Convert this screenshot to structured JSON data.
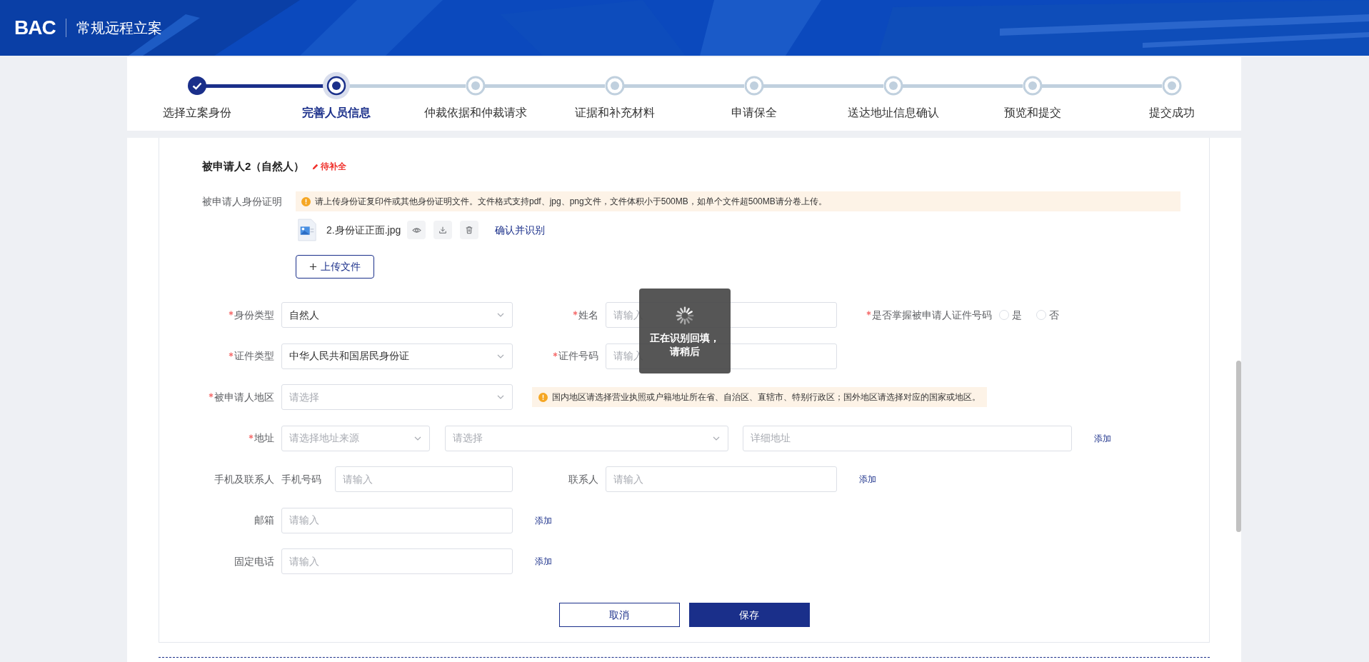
{
  "header": {
    "logo": "BAC",
    "title": "常规远程立案"
  },
  "steps": [
    {
      "label": "选择立案身份",
      "completed": true,
      "selected": false
    },
    {
      "label": "完善人员信息",
      "completed": false,
      "selected": true
    },
    {
      "label": "仲裁依据和仲裁请求",
      "completed": false,
      "selected": false
    },
    {
      "label": "证据和补充材料",
      "completed": false,
      "selected": false
    },
    {
      "label": "申请保全",
      "completed": false,
      "selected": false
    },
    {
      "label": "送达地址信息确认",
      "completed": false,
      "selected": false
    },
    {
      "label": "预览和提交",
      "completed": false,
      "selected": false
    },
    {
      "label": "提交成功",
      "completed": false,
      "selected": false
    }
  ],
  "party": {
    "title": "被申请人2（自然人）",
    "badge": "待补全",
    "id_proof": {
      "label": "被申请人身份证明",
      "tip": "请上传身份证复印件或其他身份证明文件。文件格式支持pdf、jpg、png文件，文件体积小于500MB，如单个文件超500MB请分卷上传。",
      "file": {
        "name": "2.身份证正面.jpg",
        "action": "确认并识别"
      },
      "upload_button": "上传文件"
    },
    "rows": [
      {
        "label": "身份类型",
        "required": true,
        "items": [
          {
            "kind": "select",
            "value": "自然人"
          },
          {
            "kind": "input",
            "label": "姓名",
            "required": true,
            "placeholder": "请输入"
          },
          {
            "kind": "radio_group",
            "label": "是否掌握被申请人证件号码",
            "required": true,
            "options": [
              {
                "label": "是",
                "selected": false
              },
              {
                "label": "否",
                "selected": false
              }
            ]
          }
        ]
      },
      {
        "label": "证件类型",
        "required": true,
        "items": [
          {
            "kind": "select",
            "value": "中华人民共和国居民身份证"
          },
          {
            "kind": "input",
            "label": "证件号码",
            "required": true,
            "placeholder": "请输入"
          }
        ]
      },
      {
        "label": "被申请人地区",
        "required": true,
        "items": [
          {
            "kind": "select",
            "placeholder": "请选择"
          },
          {
            "kind": "tip",
            "text": "国内地区请选择营业执照或户籍地址所在省、自治区、直辖市、特别行政区；国外地区请选择对应的国家或地区。"
          }
        ]
      },
      {
        "label": "地址",
        "required": true,
        "items": [
          {
            "kind": "select_narrow",
            "placeholder": "请选择地址来源"
          },
          {
            "kind": "select_wide",
            "placeholder": "请选择"
          },
          {
            "kind": "input_wide",
            "placeholder": "详细地址"
          },
          {
            "kind": "add_link",
            "text": "添加"
          }
        ]
      },
      {
        "label": "手机及联系人",
        "required": false,
        "items": [
          {
            "kind": "phone_input",
            "label": "手机号码",
            "placeholder": "请输入"
          },
          {
            "kind": "input",
            "label": "联系人",
            "required": false,
            "placeholder": "请输入"
          },
          {
            "kind": "add_link",
            "text": "添加"
          }
        ]
      },
      {
        "label": "邮箱",
        "required": false,
        "items": [
          {
            "kind": "input",
            "placeholder": "请输入"
          },
          {
            "kind": "add_link",
            "text": "添加"
          }
        ]
      },
      {
        "label": "固定电话",
        "required": false,
        "items": [
          {
            "kind": "input",
            "placeholder": "请输入"
          },
          {
            "kind": "add_link",
            "text": "添加"
          }
        ]
      }
    ]
  },
  "buttons": {
    "cancel": "取消",
    "save": "保存"
  },
  "loading": {
    "text": "正在识别回填，请稍后"
  }
}
